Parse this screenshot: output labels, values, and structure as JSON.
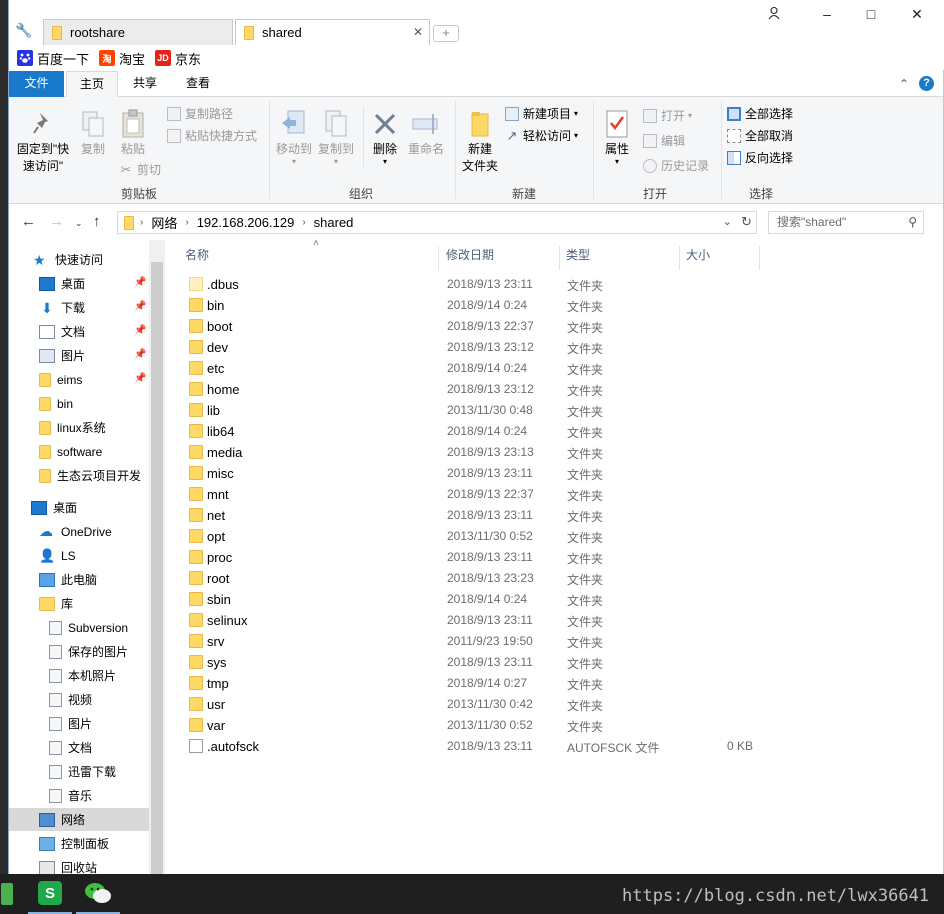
{
  "tabs": [
    {
      "label": "rootshare",
      "active": false
    },
    {
      "label": "shared",
      "active": true
    }
  ],
  "window_controls": {
    "user": "user-icon",
    "minimize": "–",
    "maximize": "□",
    "close": "✕"
  },
  "bookmarks": [
    {
      "label": "百度一下",
      "icon": "baidu-paw-icon",
      "color": "#2932e1"
    },
    {
      "label": "淘宝",
      "icon": "taobao-icon",
      "color": "#ff4400",
      "glyph": "淘"
    },
    {
      "label": "京东",
      "icon": "jd-icon",
      "color": "#e1251b",
      "glyph": "JD"
    }
  ],
  "ribbon_tabs": [
    "文件",
    "主页",
    "共享",
    "查看"
  ],
  "ribbon": {
    "clipboard": {
      "pin": "固定到\"快速访问\"",
      "pin_line1": "固定到\"快",
      "pin_line2": "速访问\"",
      "copy": "复制",
      "paste": "粘贴",
      "copy_path": "复制路径",
      "paste_shortcut": "粘贴快捷方式",
      "cut": "剪切",
      "label": "剪贴板"
    },
    "organize": {
      "move_to": "移动到",
      "copy_to": "复制到",
      "delete": "删除",
      "rename": "重命名",
      "label": "组织"
    },
    "new": {
      "new_folder_line1": "新建",
      "new_folder_line2": "文件夹",
      "new_item": "新建项目",
      "easy_access": "轻松访问",
      "label": "新建"
    },
    "open": {
      "properties": "属性",
      "open": "打开",
      "edit": "编辑",
      "history": "历史记录",
      "label": "打开"
    },
    "select": {
      "select_all": "全部选择",
      "select_none": "全部取消",
      "invert": "反向选择",
      "label": "选择"
    }
  },
  "address": {
    "segments": [
      "网络",
      "192.168.206.129",
      "shared"
    ],
    "search_placeholder": "搜索\"shared\""
  },
  "nav": {
    "quick_access": "快速访问",
    "items": [
      {
        "label": "桌面",
        "pinned": true
      },
      {
        "label": "下载",
        "pinned": true
      },
      {
        "label": "文档",
        "pinned": true
      },
      {
        "label": "图片",
        "pinned": true
      },
      {
        "label": "eims",
        "pinned": true
      },
      {
        "label": "bin",
        "pinned": false
      },
      {
        "label": "linux系统",
        "pinned": false
      },
      {
        "label": "software",
        "pinned": false
      },
      {
        "label": "生态云项目开发",
        "pinned": false
      }
    ],
    "desktop": "桌面",
    "onedrive": "OneDrive",
    "user": "LS",
    "this_pc": "此电脑",
    "library": "库",
    "library_items": [
      "Subversion",
      "保存的图片",
      "本机照片",
      "视频",
      "图片",
      "文档",
      "迅雷下载",
      "音乐"
    ],
    "network": "网络",
    "control_panel": "控制面板",
    "recycle_bin": "回收站"
  },
  "columns": {
    "name": "名称",
    "date": "修改日期",
    "type": "类型",
    "size": "大小"
  },
  "files": [
    {
      "name": ".dbus",
      "date": "2018/9/13 23:11",
      "type": "文件夹",
      "size": "",
      "kind": "folder-hidden"
    },
    {
      "name": "bin",
      "date": "2018/9/14 0:24",
      "type": "文件夹",
      "size": "",
      "kind": "folder"
    },
    {
      "name": "boot",
      "date": "2018/9/13 22:37",
      "type": "文件夹",
      "size": "",
      "kind": "folder"
    },
    {
      "name": "dev",
      "date": "2018/9/13 23:12",
      "type": "文件夹",
      "size": "",
      "kind": "folder"
    },
    {
      "name": "etc",
      "date": "2018/9/14 0:24",
      "type": "文件夹",
      "size": "",
      "kind": "folder"
    },
    {
      "name": "home",
      "date": "2018/9/13 23:12",
      "type": "文件夹",
      "size": "",
      "kind": "folder"
    },
    {
      "name": "lib",
      "date": "2013/11/30 0:48",
      "type": "文件夹",
      "size": "",
      "kind": "folder"
    },
    {
      "name": "lib64",
      "date": "2018/9/14 0:24",
      "type": "文件夹",
      "size": "",
      "kind": "folder"
    },
    {
      "name": "media",
      "date": "2018/9/13 23:13",
      "type": "文件夹",
      "size": "",
      "kind": "folder"
    },
    {
      "name": "misc",
      "date": "2018/9/13 23:11",
      "type": "文件夹",
      "size": "",
      "kind": "folder"
    },
    {
      "name": "mnt",
      "date": "2018/9/13 22:37",
      "type": "文件夹",
      "size": "",
      "kind": "folder"
    },
    {
      "name": "net",
      "date": "2018/9/13 23:11",
      "type": "文件夹",
      "size": "",
      "kind": "folder"
    },
    {
      "name": "opt",
      "date": "2013/11/30 0:52",
      "type": "文件夹",
      "size": "",
      "kind": "folder"
    },
    {
      "name": "proc",
      "date": "2018/9/13 23:11",
      "type": "文件夹",
      "size": "",
      "kind": "folder"
    },
    {
      "name": "root",
      "date": "2018/9/13 23:23",
      "type": "文件夹",
      "size": "",
      "kind": "folder"
    },
    {
      "name": "sbin",
      "date": "2018/9/14 0:24",
      "type": "文件夹",
      "size": "",
      "kind": "folder"
    },
    {
      "name": "selinux",
      "date": "2018/9/13 23:11",
      "type": "文件夹",
      "size": "",
      "kind": "folder"
    },
    {
      "name": "srv",
      "date": "2011/9/23 19:50",
      "type": "文件夹",
      "size": "",
      "kind": "folder"
    },
    {
      "name": "sys",
      "date": "2018/9/13 23:11",
      "type": "文件夹",
      "size": "",
      "kind": "folder"
    },
    {
      "name": "tmp",
      "date": "2018/9/14 0:27",
      "type": "文件夹",
      "size": "",
      "kind": "folder"
    },
    {
      "name": "usr",
      "date": "2013/11/30 0:42",
      "type": "文件夹",
      "size": "",
      "kind": "folder"
    },
    {
      "name": "var",
      "date": "2013/11/30 0:52",
      "type": "文件夹",
      "size": "",
      "kind": "folder"
    },
    {
      "name": ".autofsck",
      "date": "2018/9/13 23:11",
      "type": "AUTOFSCK 文件",
      "size": "0 KB",
      "kind": "file"
    }
  ],
  "taskbar": {
    "watermark": "https://blog.csdn.net/lwx36641",
    "apps": [
      "wps-spreadsheet-icon",
      "wechat-icon"
    ]
  },
  "colors": {
    "accent": "#1979ca",
    "folder": "#ffd965",
    "taskbar": "#1f1f1f"
  }
}
